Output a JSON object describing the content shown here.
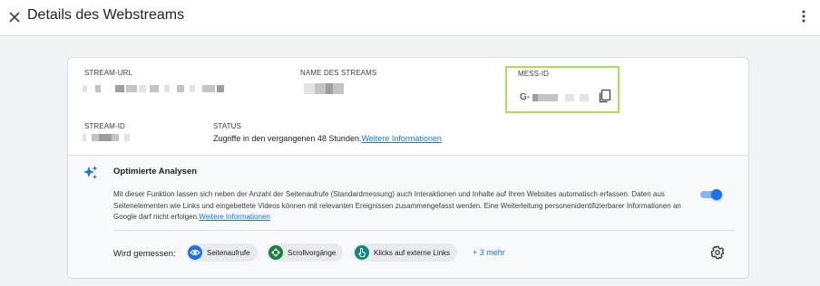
{
  "header": {
    "title": "Details des Webstreams"
  },
  "stream": {
    "url_label": "STREAM-URL",
    "name_label": "NAME DES STREAMS",
    "mess_label": "MESS-ID",
    "mess_prefix": "G-",
    "id_label": "STREAM-ID",
    "status_label": "STATUS",
    "status_text": "Zugriffe in den vergangenen 48 Stunden.",
    "status_link": "Weitere Informationen"
  },
  "analyse": {
    "title": "Optimierte Analysen",
    "description": "Mit dieser Funktion lassen sich neben der Anzahl der Seitenaufrufe (Standardmessung) auch Interaktionen und Inhalte auf Ihren Websites automatisch erfassen. Daten aus Seitenelementen wie Links und eingebettete Videos können mit relevanten Ereignissen zusammengefasst werden. Eine Weiterleitung personenidentifizierbarer Informationen an Google darf nicht erfolgen.",
    "link": "Weitere Informationen",
    "enabled": true,
    "measured_label": "Wird gemessen:",
    "chips": [
      {
        "label": "Seitenaufrufe",
        "icon": "eye-icon",
        "color": "#1a73e8"
      },
      {
        "label": "Scrollvorgänge",
        "icon": "scroll-icon",
        "color": "#188038"
      },
      {
        "label": "Klicks auf externe Links",
        "icon": "click-icon",
        "color": "#12887a"
      }
    ],
    "more": "+ 3 mehr"
  },
  "colors": {
    "accent": "#1a73e8",
    "highlight": "#a7e34a"
  }
}
